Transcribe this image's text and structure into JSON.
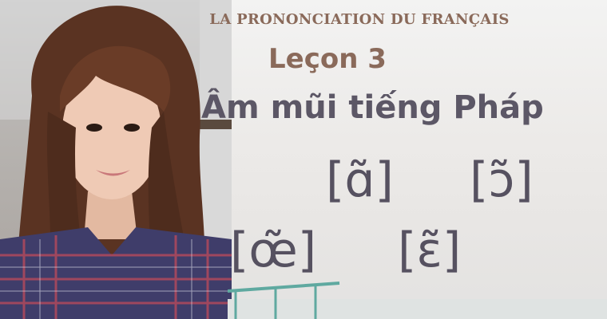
{
  "header": {
    "course_title": "LA PRONONCIATION DU FRANÇAIS",
    "lesson_label": "Leçon 3",
    "lesson_subtitle": "Âm mũi tiếng Pháp"
  },
  "phonetic_symbols": [
    "[ɑ̃]",
    "[ɔ̃]",
    "[œ̃]",
    "[ɛ̃]"
  ],
  "colors": {
    "title_brown": "#8a6a5a",
    "subtitle_gray": "#5c5766",
    "symbol_gray": "#565160"
  },
  "media": {
    "photo_subject": "teacher-portrait"
  }
}
